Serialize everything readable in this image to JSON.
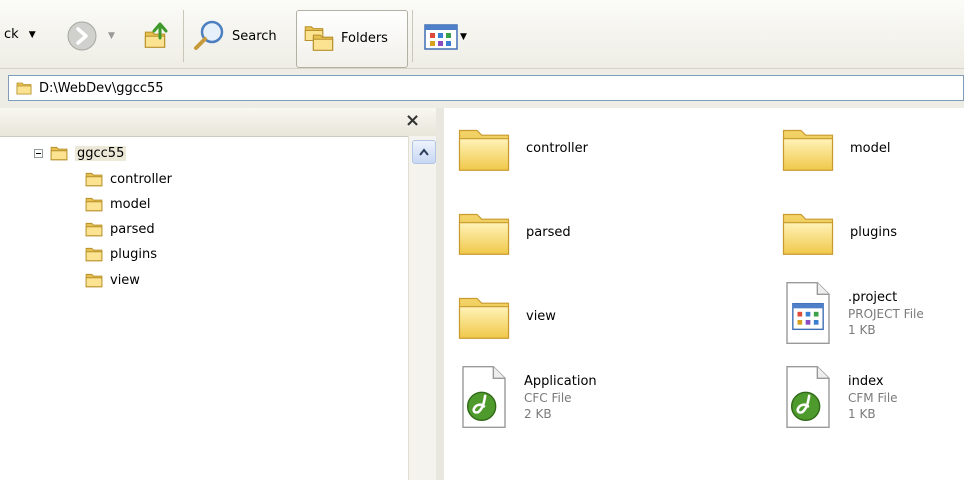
{
  "toolbar": {
    "back_label": "ck",
    "search_label": "Search",
    "folders_label": "Folders"
  },
  "address": {
    "path": "D:\\WebDev\\ggcc55"
  },
  "folders_pane": {
    "close_glyph": "×",
    "tree": {
      "root": "ggcc55",
      "children": [
        "controller",
        "model",
        "parsed",
        "plugins",
        "view"
      ]
    }
  },
  "content": {
    "items": [
      {
        "name": "controller",
        "type": "folder"
      },
      {
        "name": "model",
        "type": "folder"
      },
      {
        "name": "parsed",
        "type": "folder"
      },
      {
        "name": "plugins",
        "type": "folder"
      },
      {
        "name": "view",
        "type": "folder"
      },
      {
        "name": ".project",
        "type_label": "PROJECT File",
        "size": "1 KB",
        "icon": "project-file-icon"
      },
      {
        "name": "Application",
        "type_label": "CFC File",
        "size": "2 KB",
        "icon": "dreamweaver-file-icon"
      },
      {
        "name": "index",
        "type_label": "CFM File",
        "size": "1 KB",
        "icon": "dreamweaver-file-icon"
      }
    ]
  },
  "colors": {
    "folder_yellow": "#f7d86b",
    "toolbar_bg": "#eeede5",
    "dw_green": "#4f9a2d"
  }
}
